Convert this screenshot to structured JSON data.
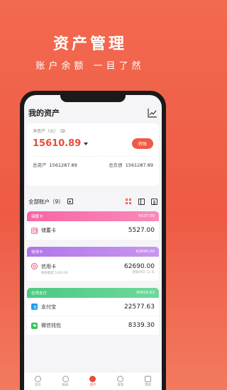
{
  "hero": {
    "title": "资产管理",
    "subtitle": "账户余额  一目了然"
  },
  "screen": {
    "title": "我的资产"
  },
  "net_assets": {
    "label": "净资产（元）",
    "value": "15610.89",
    "transfer_label": "转账",
    "total_assets_label": "总资产",
    "total_assets_value": "1561287.89",
    "total_liabilities_label": "总负债",
    "total_liabilities_value": "1561287.89"
  },
  "accounts_header": {
    "label": "全部账户（9）"
  },
  "groups": [
    {
      "name": "储蓄卡",
      "total": "5527.00",
      "color_from": "#f766a6",
      "color_to": "#f98ab8"
    },
    {
      "name": "信用卡",
      "total": "62690.00",
      "color_from": "#b076e8",
      "color_to": "#c896f0"
    },
    {
      "name": "在线支付",
      "total": "30916.63",
      "color_from": "#4cc983",
      "color_to": "#6fd89a"
    }
  ],
  "accounts": [
    {
      "name": "储蓄卡",
      "amount": "5527.00"
    },
    {
      "name": "信用卡",
      "amount": "62690.00",
      "sub": "剩余额度 1000.00",
      "sub2": "距账单日 12 天"
    },
    {
      "name": "支付宝",
      "amount": "22577.63"
    },
    {
      "name": "微信钱包",
      "amount": "8339.30"
    }
  ],
  "nav": [
    {
      "label": "首页"
    },
    {
      "label": "报表"
    },
    {
      "label": "资产"
    },
    {
      "label": "发现"
    },
    {
      "label": "我的"
    }
  ],
  "colors": {
    "accent": "#e84d3a",
    "hero_bg": "#ee5a45"
  }
}
